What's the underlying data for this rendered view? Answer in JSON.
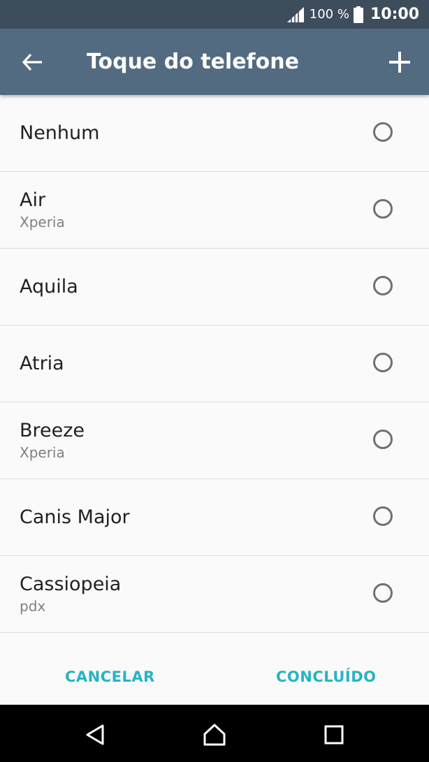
{
  "status_bar": {
    "battery_percent": "100 %",
    "time": "10:00"
  },
  "app_bar": {
    "title": "Toque do telefone"
  },
  "ringtones": [
    {
      "title": "Nenhum",
      "subtitle": "",
      "selected": false
    },
    {
      "title": "Air",
      "subtitle": "Xperia",
      "selected": false
    },
    {
      "title": "Aquila",
      "subtitle": "",
      "selected": false
    },
    {
      "title": "Atria",
      "subtitle": "",
      "selected": false
    },
    {
      "title": "Breeze",
      "subtitle": "Xperia",
      "selected": false
    },
    {
      "title": "Canis Major",
      "subtitle": "",
      "selected": false
    },
    {
      "title": "Cassiopeia",
      "subtitle": "pdx",
      "selected": false
    }
  ],
  "buttons": {
    "cancel_label": "CANCELAR",
    "done_label": "CONCLUÍDO"
  },
  "colors": {
    "status_bar": "#3e4d5c",
    "app_bar": "#536b80",
    "accent": "#26b3c8"
  }
}
